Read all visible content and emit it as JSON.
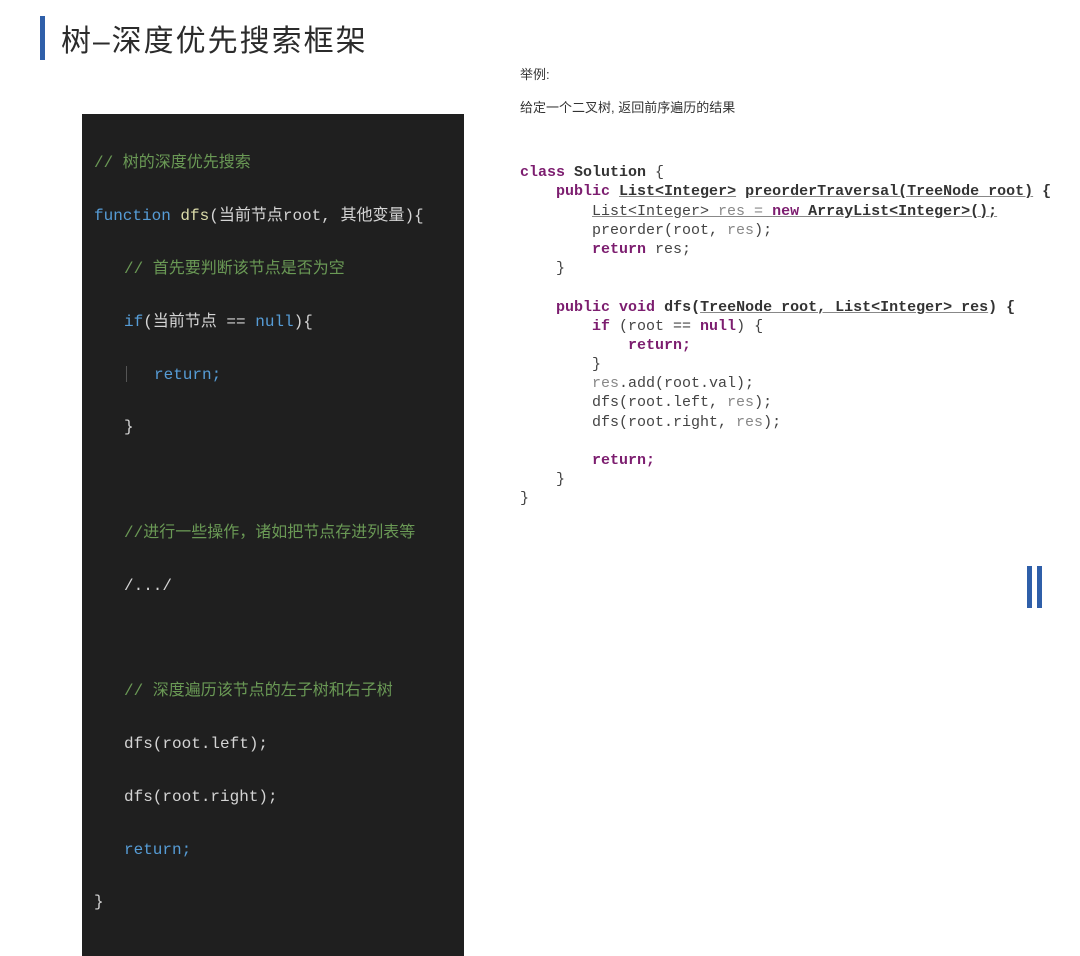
{
  "title": "树–深度优先搜索框架",
  "left_code": {
    "c1": "// 树的深度优先搜索",
    "fn_kw": "function",
    "fn_name": "dfs",
    "fn_params": "(当前节点root, 其他变量){",
    "c2": "// 首先要判断该节点是否为空",
    "if_kw": "if",
    "if_cond": "(当前节点 == ",
    "null_kw": "null",
    "if_close": "){",
    "ret": "return;",
    "brace_close": "}",
    "c3": "//进行一些操作，诸如把节点存进列表等",
    "c4": "/.../",
    "c5": "// 深度遍历该节点的左子树和右子树",
    "call_left": "dfs(root.left);",
    "call_right": "dfs(root.right);",
    "ret2": "return;",
    "brace_end": "}"
  },
  "right": {
    "example_label": "举例:",
    "example_desc": "给定一个二叉树, 返回前序遍历的结果",
    "java": {
      "class_kw": "class",
      "class_name": "Solution",
      "brace_open": " {",
      "m1_sig_a": "public",
      "m1_sig_b": "List<Integer>",
      "m1_sig_c": "preorderTraversal(TreeNode root)",
      "m1_sig_d": " {",
      "m1_l1_a": "List<Integer>",
      "m1_l1_b": " res = ",
      "m1_l1_c": "new",
      "m1_l1_d": " ArrayList<Integer>();",
      "m1_l2_a": "preorder(root, ",
      "m1_l2_b": "res",
      "m1_l2_c": ");",
      "m1_l3_a": "return",
      "m1_l3_b": " res;",
      "m1_close": "}",
      "m2_sig_a": "public void",
      "m2_sig_b": "dfs(",
      "m2_sig_c": "TreeNode root, List<Integer> res",
      "m2_sig_d": ") {",
      "m2_l1_a": "if",
      "m2_l1_b": " (root == ",
      "m2_l1_c": "null",
      "m2_l1_d": ") {",
      "m2_l2": "return;",
      "m2_l3": "}",
      "m2_l4_a": "res",
      "m2_l4_b": ".add(root.val);",
      "m2_l5_a": "dfs(root.left, ",
      "m2_l5_b": "res",
      "m2_l5_c": ");",
      "m2_l6_a": "dfs(root.right, ",
      "m2_l6_b": "res",
      "m2_l6_c": ");",
      "m2_l7": "return;",
      "m2_close": "}",
      "class_close": "}"
    }
  }
}
